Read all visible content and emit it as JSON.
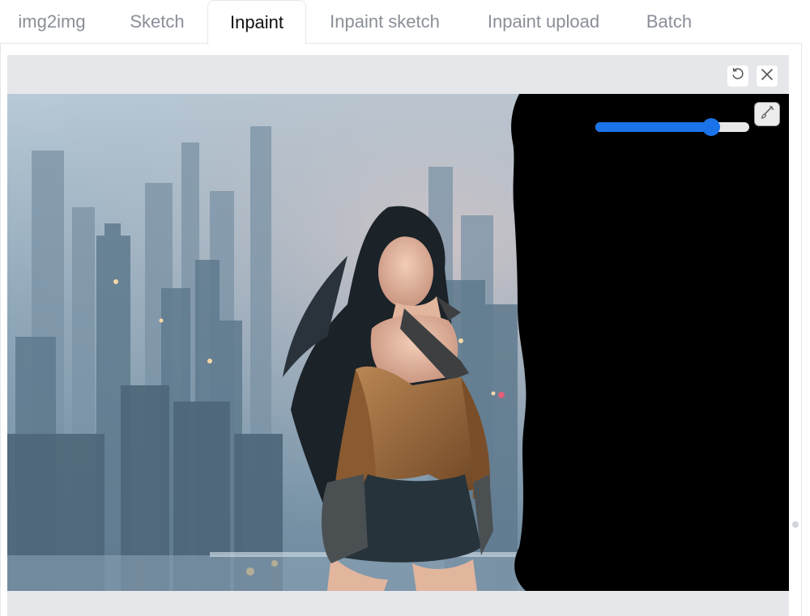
{
  "tabs": [
    {
      "label": "img2img",
      "selected": false
    },
    {
      "label": "Sketch",
      "selected": false
    },
    {
      "label": "Inpaint",
      "selected": true
    },
    {
      "label": "Inpaint sketch",
      "selected": false
    },
    {
      "label": "Inpaint upload",
      "selected": false
    },
    {
      "label": "Batch",
      "selected": false
    }
  ],
  "editor": {
    "toolbar_icons": [
      "undo-icon",
      "close-icon"
    ],
    "brush_size_fraction": 0.75,
    "brush_tool_icon": "brush-icon",
    "mask_color": "#000000",
    "accent_color": "#1a73e8"
  }
}
